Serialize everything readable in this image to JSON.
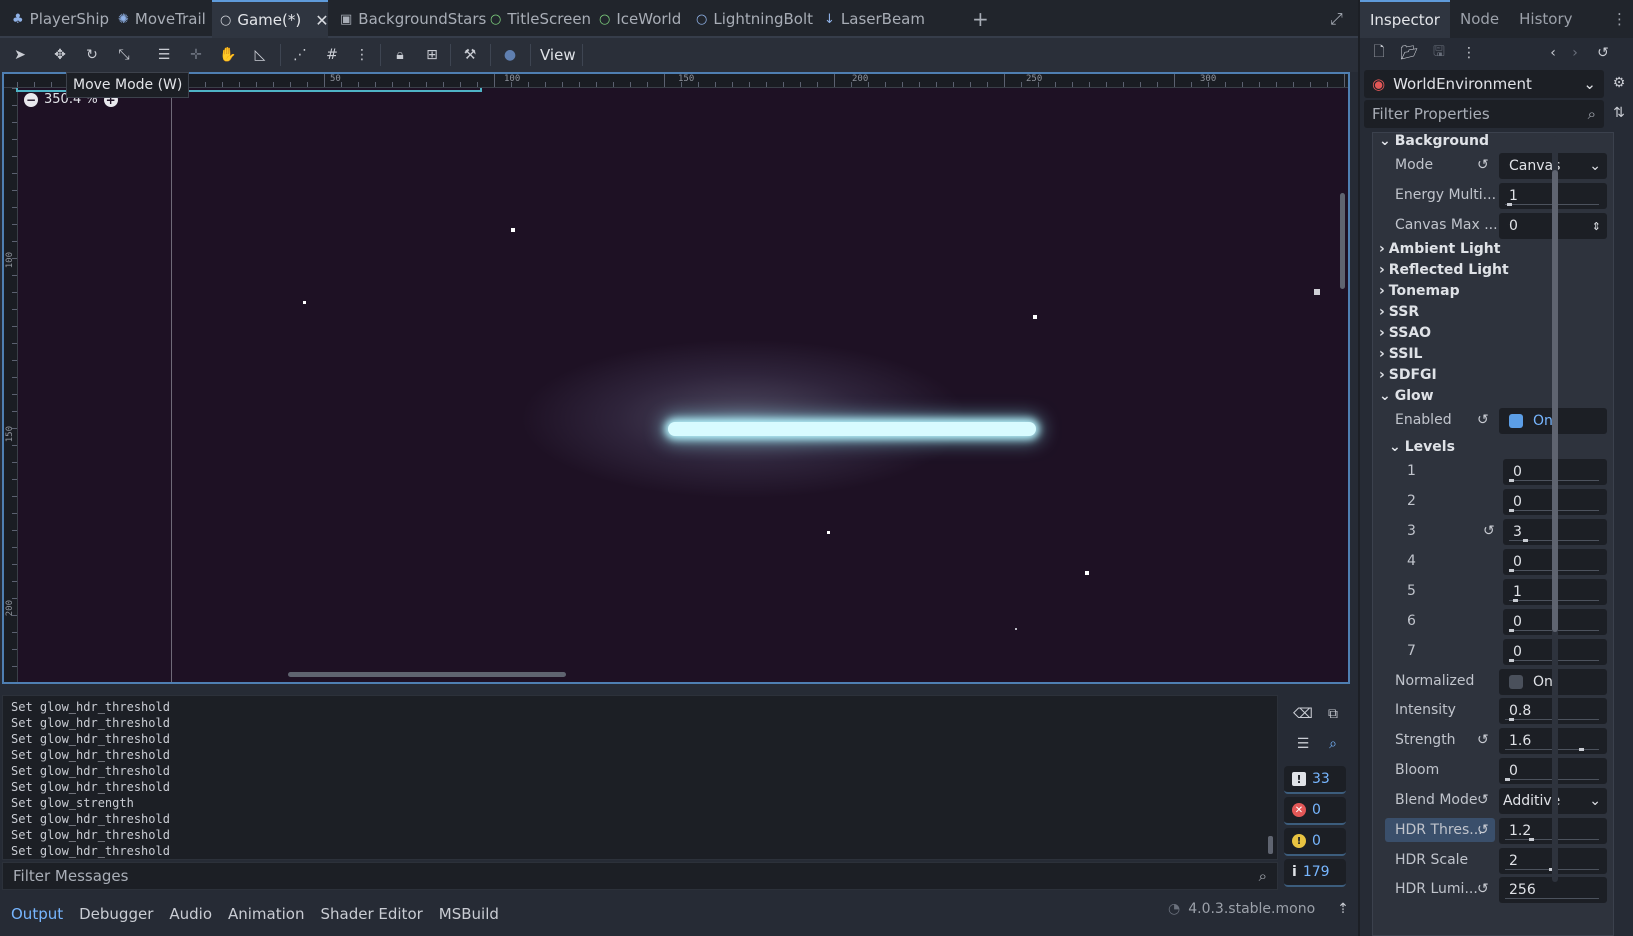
{
  "scene_tabs": [
    {
      "label": "PlayerShip",
      "icon": "sprite-icon",
      "active": false
    },
    {
      "label": "MoveTrail",
      "icon": "particles-icon",
      "active": false
    },
    {
      "label": "Game(*)",
      "icon": "node-icon",
      "active": true
    },
    {
      "label": "BackgroundStars",
      "icon": "scene-icon",
      "active": false
    },
    {
      "label": "TitleScreen",
      "icon": "control-icon",
      "active": false
    },
    {
      "label": "IceWorld",
      "icon": "control-icon",
      "active": false
    },
    {
      "label": "LightningBolt",
      "icon": "node-icon",
      "active": false
    },
    {
      "label": "LaserBeam",
      "icon": "pin-icon",
      "active": false
    }
  ],
  "toolbar": {
    "view_label": "View"
  },
  "viewport": {
    "tooltip": "Move Mode (W)",
    "zoom": "350.4 %",
    "ruler_top": [
      "50",
      "100",
      "150",
      "200",
      "250",
      "300"
    ],
    "ruler_left": [
      "100",
      "150",
      "200"
    ]
  },
  "output": {
    "lines": [
      "Set glow_hdr_threshold",
      "Set glow_hdr_threshold",
      "Set glow_hdr_threshold",
      "Set glow_hdr_threshold",
      "Set glow_hdr_threshold",
      "Set glow_hdr_threshold",
      "Set glow_strength",
      "Set glow_hdr_threshold",
      "Set glow_hdr_threshold",
      "Set glow_hdr_threshold"
    ],
    "counts": {
      "messages": "33",
      "errors": "0",
      "warnings": "0",
      "info": "179"
    },
    "filter_placeholder": "Filter Messages"
  },
  "bottom_tabs": [
    "Output",
    "Debugger",
    "Audio",
    "Animation",
    "Shader Editor",
    "MSBuild"
  ],
  "version": "4.0.3.stable.mono",
  "inspector": {
    "tabs": [
      "Inspector",
      "Node",
      "History"
    ],
    "node_name": "WorldEnvironment",
    "filter_placeholder": "Filter Properties",
    "sections": {
      "background": "Background",
      "ambient": "Ambient Light",
      "reflected": "Reflected Light",
      "tonemap": "Tonemap",
      "ssr": "SSR",
      "ssao": "SSAO",
      "ssil": "SSIL",
      "sdfgi": "SDFGI",
      "glow": "Glow",
      "levels": "Levels"
    },
    "props": {
      "mode_label": "Mode",
      "mode_value": "Canvas",
      "energy_label": "Energy Multi...",
      "energy_value": "1",
      "canvas_max_label": "Canvas Max ...",
      "canvas_max_value": "0",
      "enabled_label": "Enabled",
      "enabled_value": "On",
      "levels": [
        {
          "label": "1",
          "value": "0"
        },
        {
          "label": "2",
          "value": "0"
        },
        {
          "label": "3",
          "value": "3"
        },
        {
          "label": "4",
          "value": "0"
        },
        {
          "label": "5",
          "value": "1"
        },
        {
          "label": "6",
          "value": "0"
        },
        {
          "label": "7",
          "value": "0"
        }
      ],
      "normalized_label": "Normalized",
      "normalized_value": "On",
      "intensity_label": "Intensity",
      "intensity_value": "0.8",
      "strength_label": "Strength",
      "strength_value": "1.6",
      "bloom_label": "Bloom",
      "bloom_value": "0",
      "blend_label": "Blend Mode",
      "blend_value": "Additive",
      "hdr_thres_label": "HDR Thres...",
      "hdr_thres_value": "1.2",
      "hdr_scale_label": "HDR Scale",
      "hdr_scale_value": "2",
      "hdr_lumi_label": "HDR Lumi...",
      "hdr_lumi_value": "256"
    }
  },
  "colors": {
    "accent": "#77b6ff",
    "scene_bg": "#1e1124",
    "laser": "#d8fbff",
    "error": "#e25757",
    "warning": "#e8c341"
  }
}
